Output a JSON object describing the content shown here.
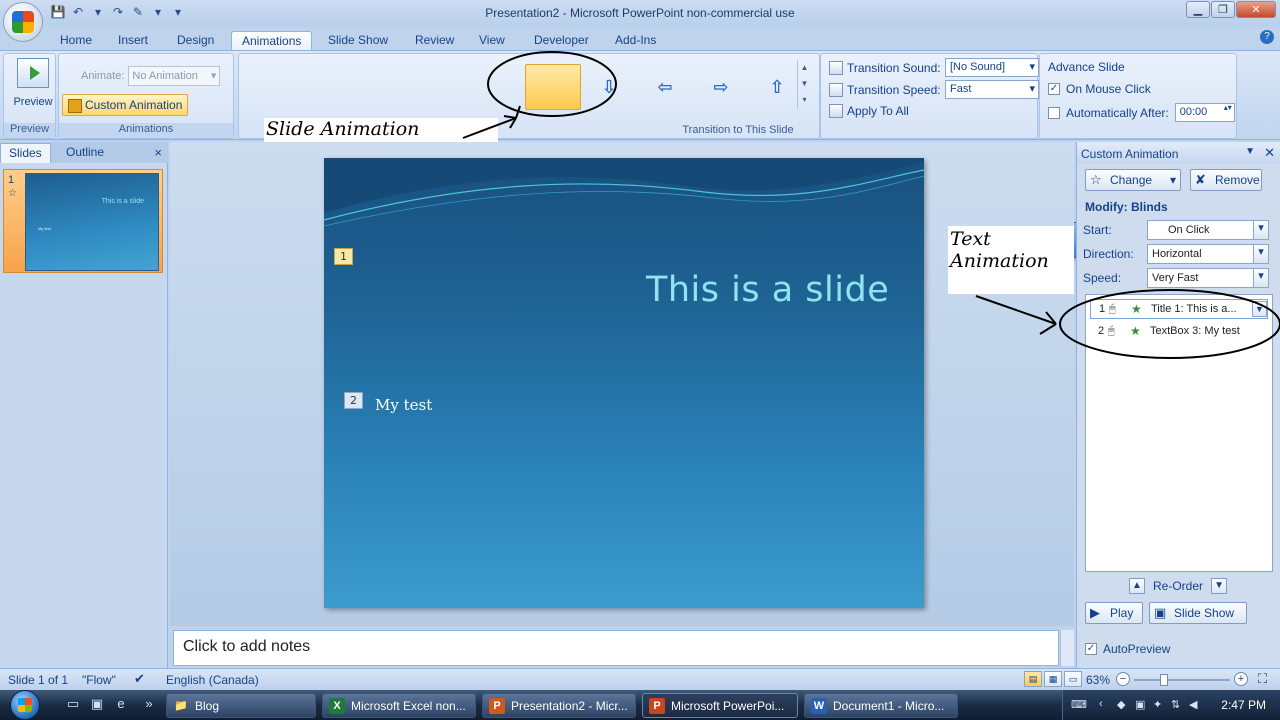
{
  "window": {
    "title": "Presentation2 - Microsoft PowerPoint non-commercial use",
    "minimize": "▁",
    "maximize": "❐",
    "close": "✕"
  },
  "qat": [
    "💾",
    "↶",
    "▾",
    "↷",
    "✎",
    "▾",
    "▾"
  ],
  "ribbon_tabs": [
    "Home",
    "Insert",
    "Design",
    "Animations",
    "Slide Show",
    "Review",
    "View",
    "Developer",
    "Add-Ins"
  ],
  "active_tab": "Animations",
  "preview_group": {
    "button": "Preview",
    "label": "Preview"
  },
  "animations_group": {
    "animate_label": "Animate:",
    "animate_value": "No Animation",
    "custom_animation": "Custom Animation",
    "label": "Animations"
  },
  "transition_group": {
    "label": "Transition to This Slide",
    "sound_label": "Transition Sound:",
    "sound_value": "[No Sound]",
    "speed_label": "Transition Speed:",
    "speed_value": "Fast",
    "apply_all": "Apply To All"
  },
  "advance_group": {
    "title": "Advance Slide",
    "on_mouse_click": "On Mouse Click",
    "on_mouse_click_checked": "✓",
    "auto_after": "Automatically After:",
    "auto_time": "00:00"
  },
  "annotations": {
    "slide_animation": "Slide Animation",
    "text_animation": "Text Animation"
  },
  "slides_pane": {
    "tab_slides": "Slides",
    "tab_outline": "Outline",
    "close": "×",
    "thumb_number": "1",
    "thumb_star": "☆",
    "thumb_title": "This is a slide",
    "thumb_body": "My test"
  },
  "slide": {
    "tag1": "1",
    "tag2": "2",
    "title": "This is a slide",
    "body": "My test"
  },
  "notes": {
    "placeholder": "Click to add notes"
  },
  "custom_animation_pane": {
    "title": "Custom Animation",
    "change": "Change",
    "remove": "Remove",
    "modify": "Modify: Blinds",
    "start_label": "Start:",
    "start_value": "On Click",
    "direction_label": "Direction:",
    "direction_value": "Horizontal",
    "speed_label": "Speed:",
    "speed_value": "Very Fast",
    "items": [
      {
        "num": "1",
        "label": "Title 1:  This is a..."
      },
      {
        "num": "2",
        "label": "TextBox 3: My test"
      }
    ],
    "reorder": "Re-Order",
    "play": "Play",
    "slide_show": "Slide Show",
    "autopreview": "AutoPreview",
    "autopreview_checked": "✓"
  },
  "status_bar": {
    "slide_info": "Slide 1 of 1",
    "theme": "\"Flow\"",
    "language": "English (Canada)",
    "zoom": "63%",
    "zoom_level": 0.63
  },
  "taskbar": {
    "tasks": [
      {
        "label": "Blog",
        "icon_color": "#c79a2a",
        "icon": "📁"
      },
      {
        "label": "Microsoft Excel non...",
        "icon_color": "#1f7a3a",
        "icon": "X"
      },
      {
        "label": "Presentation2 - Micr...",
        "icon_color": "#d05a1e",
        "icon": "P"
      },
      {
        "label": "Microsoft PowerPoi...",
        "icon_color": "#c8461a",
        "icon": "P"
      },
      {
        "label": "Document1 - Micro...",
        "icon_color": "#2b5fb3",
        "icon": "W"
      }
    ],
    "clock": "2:47 PM"
  },
  "colors": {
    "ribbon_bg": "#c5d9f1",
    "slide_title": "#8fe5ef",
    "slide_bg": "#1f6596",
    "selected_gallery": "#ffc94d"
  }
}
